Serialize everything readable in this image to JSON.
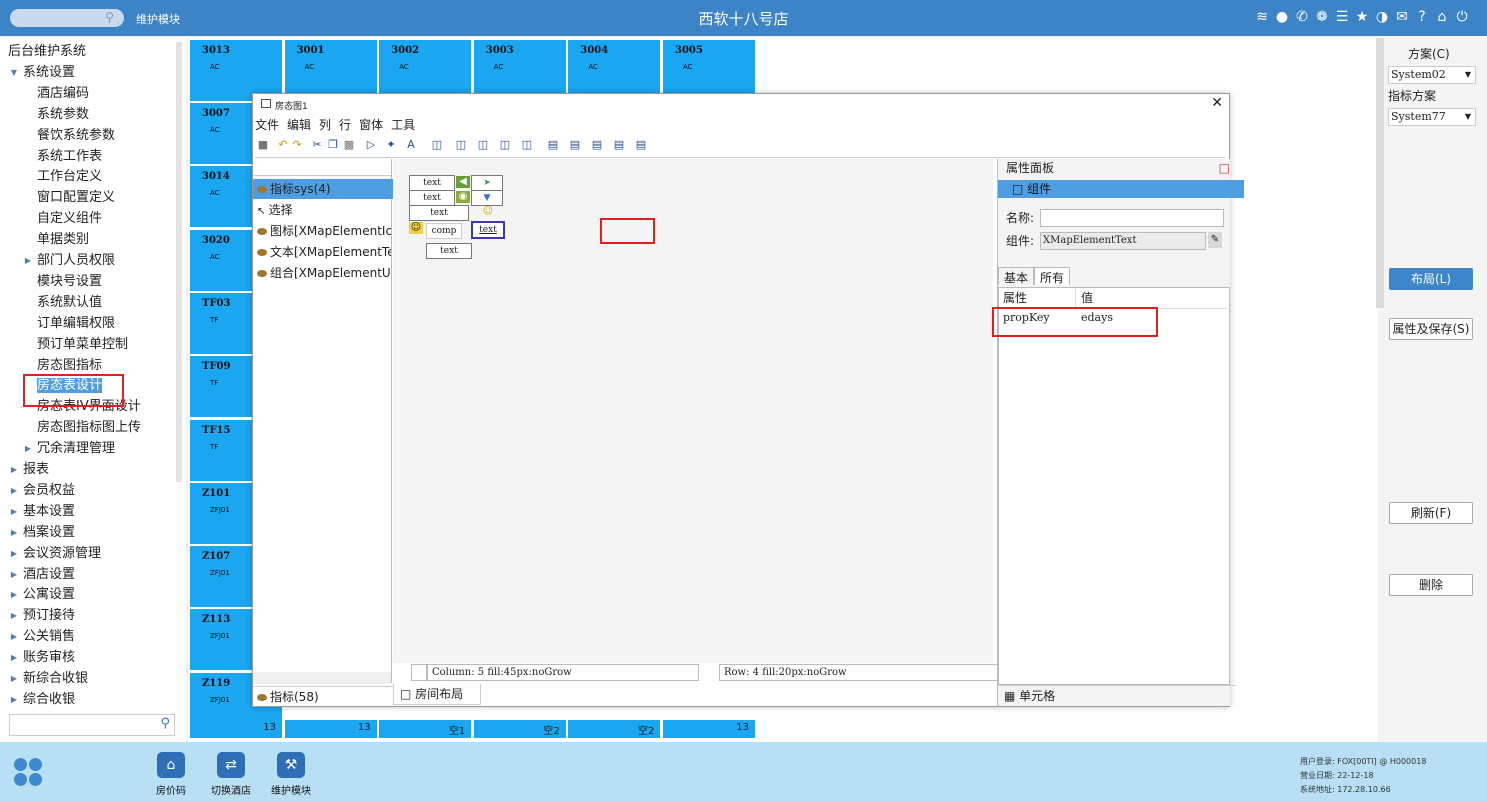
{
  "topbar": {
    "module": "维护模块",
    "title": "西软十八号店"
  },
  "sidebar": {
    "items": [
      {
        "label": "后台维护系统",
        "level": 0,
        "arrow": ""
      },
      {
        "label": "系统设置",
        "level": 1,
        "arrow": "▼"
      },
      {
        "label": "酒店编码",
        "level": 2,
        "arrow": ""
      },
      {
        "label": "系统参数",
        "level": 2,
        "arrow": ""
      },
      {
        "label": "餐饮系统参数",
        "level": 2,
        "arrow": ""
      },
      {
        "label": "系统工作表",
        "level": 2,
        "arrow": ""
      },
      {
        "label": "工作台定义",
        "level": 2,
        "arrow": ""
      },
      {
        "label": "窗口配置定义",
        "level": 2,
        "arrow": ""
      },
      {
        "label": "自定义组件",
        "level": 2,
        "arrow": ""
      },
      {
        "label": "单据类别",
        "level": 2,
        "arrow": ""
      },
      {
        "label": "部门人员权限",
        "level": 2,
        "arrow": "▶"
      },
      {
        "label": "模块号设置",
        "level": 2,
        "arrow": ""
      },
      {
        "label": "系统默认值",
        "level": 2,
        "arrow": ""
      },
      {
        "label": "订单编辑权限",
        "level": 2,
        "arrow": ""
      },
      {
        "label": "预订单菜单控制",
        "level": 2,
        "arrow": ""
      },
      {
        "label": "房态图指标",
        "level": 2,
        "arrow": ""
      },
      {
        "label": "房态表设计",
        "level": 2,
        "arrow": "",
        "selected": true
      },
      {
        "label": "房态表IV界面设计",
        "level": 2,
        "arrow": ""
      },
      {
        "label": "房态图指标图上传",
        "level": 2,
        "arrow": ""
      },
      {
        "label": "冗余清理管理",
        "level": 2,
        "arrow": "▶"
      },
      {
        "label": "报表",
        "level": 1,
        "arrow": "▶"
      },
      {
        "label": "会员权益",
        "level": 1,
        "arrow": "▶"
      },
      {
        "label": "基本设置",
        "level": 1,
        "arrow": "▶"
      },
      {
        "label": "档案设置",
        "level": 1,
        "arrow": "▶"
      },
      {
        "label": "会议资源管理",
        "level": 1,
        "arrow": "▶"
      },
      {
        "label": "酒店设置",
        "level": 1,
        "arrow": "▶"
      },
      {
        "label": "公寓设置",
        "level": 1,
        "arrow": "▶"
      },
      {
        "label": "预订接待",
        "level": 1,
        "arrow": "▶"
      },
      {
        "label": "公关销售",
        "level": 1,
        "arrow": "▶"
      },
      {
        "label": "账务审核",
        "level": 1,
        "arrow": "▶"
      },
      {
        "label": "新综合收银",
        "level": 1,
        "arrow": "▶"
      },
      {
        "label": "综合收银",
        "level": 1,
        "arrow": "▶"
      }
    ]
  },
  "rooms_top": [
    {
      "no": "3013",
      "type": "AC"
    },
    {
      "no": "3001",
      "type": "AC"
    },
    {
      "no": "3002",
      "type": "AC"
    },
    {
      "no": "3003",
      "type": "AC"
    },
    {
      "no": "3004",
      "type": "AC"
    },
    {
      "no": "3005",
      "type": "AC"
    }
  ],
  "rooms_left": [
    {
      "no": "3007",
      "type": "AC"
    },
    {
      "no": "3014",
      "type": "AC"
    },
    {
      "no": "3020",
      "type": "AC"
    },
    {
      "no": "TF03",
      "type": "TF"
    },
    {
      "no": "TF09",
      "type": "TF"
    },
    {
      "no": "TF15",
      "type": "TF"
    },
    {
      "no": "Z101",
      "type": "ZFJ01"
    },
    {
      "no": "Z107",
      "type": "ZFJ01"
    },
    {
      "no": "Z113",
      "type": "ZFJ01"
    },
    {
      "no": "Z119",
      "type": "ZFJ01"
    }
  ],
  "bottom_row": [
    "13",
    "13",
    "空1",
    "空2",
    "空2",
    "13"
  ],
  "rightpanel": {
    "scheme_label": "方案(C)",
    "scheme_value": "System02",
    "index_label": "指标方案",
    "index_value": "System77",
    "layout_btn": "布局(L)",
    "save_btn": "属性及保存(S)",
    "refresh_btn": "刷新(F)",
    "delete_btn": "删除"
  },
  "footer": {
    "buttons": [
      "房价码",
      "切换酒店",
      "维护模块"
    ],
    "user": "用户登录:  FOX[00TI] @ H000018",
    "date": "营业日期:  22-12-18",
    "addr": "系统地址:  172.28.10.66"
  },
  "window": {
    "title": "房态图1",
    "menu": [
      "文件",
      "编辑",
      "列",
      "行",
      "窗体",
      "工具"
    ],
    "left_items": [
      {
        "label": "指标sys(4)",
        "selected": true,
        "dot": true
      },
      {
        "label": "选择",
        "dot": false
      },
      {
        "label": "图标[XMapElementIcon]",
        "dot": true
      },
      {
        "label": "文本[XMapElementText]",
        "dot": true
      },
      {
        "label": "组合[XMapElementUnit]",
        "dot": true
      }
    ],
    "left_footer": "指标(58)",
    "cells": {
      "t1": "text",
      "t2": "text",
      "t3": "text",
      "t4": "text",
      "t5": "text",
      "comp": "comp"
    },
    "status_col": "Column: 5  fill:45px:noGrow",
    "status_row": "Row: 4  fill:20px:noGrow",
    "canvas_tab": "房间布局",
    "props": {
      "header": "属性面板",
      "group": "组件",
      "name_label": "名称:",
      "name_value": "",
      "comp_label": "组件:",
      "comp_value": "XMapElementText",
      "tab_basic": "基本",
      "tab_all": "所有",
      "col_attr": "属性",
      "col_value": "值",
      "row_key": "propKey",
      "row_value": "edays",
      "footer": "单元格"
    }
  }
}
